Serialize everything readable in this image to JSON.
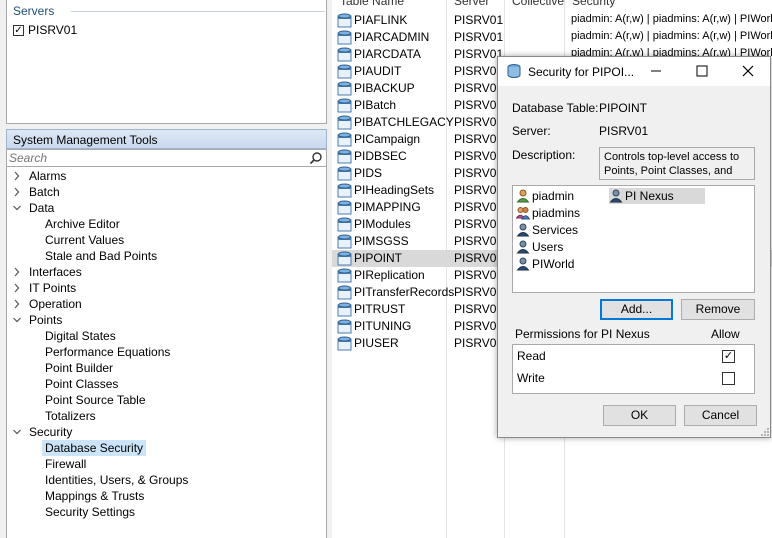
{
  "servers": {
    "title": "Servers",
    "items": [
      {
        "label": "PISRV01",
        "checked": true
      }
    ]
  },
  "tools": {
    "title": "System Management Tools",
    "search_placeholder": "Search",
    "tree": [
      {
        "label": "Alarms",
        "level": 0,
        "expanded": false
      },
      {
        "label": "Batch",
        "level": 0,
        "expanded": false
      },
      {
        "label": "Data",
        "level": 0,
        "expanded": true
      },
      {
        "label": "Archive Editor",
        "level": 1
      },
      {
        "label": "Current Values",
        "level": 1
      },
      {
        "label": "Stale and Bad Points",
        "level": 1
      },
      {
        "label": "Interfaces",
        "level": 0,
        "expanded": false
      },
      {
        "label": "IT Points",
        "level": 0,
        "expanded": false
      },
      {
        "label": "Operation",
        "level": 0,
        "expanded": false
      },
      {
        "label": "Points",
        "level": 0,
        "expanded": true
      },
      {
        "label": "Digital States",
        "level": 1
      },
      {
        "label": "Performance Equations",
        "level": 1
      },
      {
        "label": "Point Builder",
        "level": 1
      },
      {
        "label": "Point Classes",
        "level": 1
      },
      {
        "label": "Point Source Table",
        "level": 1
      },
      {
        "label": "Totalizers",
        "level": 1
      },
      {
        "label": "Security",
        "level": 0,
        "expanded": true
      },
      {
        "label": "Database Security",
        "level": 1,
        "selected": true
      },
      {
        "label": "Firewall",
        "level": 1
      },
      {
        "label": "Identities, Users, & Groups",
        "level": 1
      },
      {
        "label": "Mappings & Trusts",
        "level": 1
      },
      {
        "label": "Security Settings",
        "level": 1
      }
    ]
  },
  "table": {
    "columns": [
      "Table Name",
      "Server",
      "Collective",
      "Security"
    ],
    "rows": [
      {
        "name": "PIAFLINK",
        "server": "PISRV01",
        "security": "piadmin: A(r,w) | piadmins: A(r,w) | PIWorld: A(r)"
      },
      {
        "name": "PIARCADMIN",
        "server": "PISRV01",
        "security": "piadmin: A(r,w) | piadmins: A(r,w) | PIWorld: A(r)"
      },
      {
        "name": "PIARCDATA",
        "server": "PISRV01",
        "security": "piadmin: A(r,w) | piadmins: A(r,w) | PIWorld: A(r)"
      },
      {
        "name": "PIAUDIT",
        "server": "PISRV01",
        "security": ""
      },
      {
        "name": "PIBACKUP",
        "server": "PISRV01",
        "security": ""
      },
      {
        "name": "PIBatch",
        "server": "PISRV01",
        "security": ""
      },
      {
        "name": "PIBATCHLEGACY",
        "server": "PISRV01",
        "security": ""
      },
      {
        "name": "PICampaign",
        "server": "PISRV01",
        "security": ""
      },
      {
        "name": "PIDBSEC",
        "server": "PISRV01",
        "security": ""
      },
      {
        "name": "PIDS",
        "server": "PISRV01",
        "security": ""
      },
      {
        "name": "PIHeadingSets",
        "server": "PISRV01",
        "security": ""
      },
      {
        "name": "PIMAPPING",
        "server": "PISRV01",
        "security": ""
      },
      {
        "name": "PIModules",
        "server": "PISRV01",
        "security": ""
      },
      {
        "name": "PIMSGSS",
        "server": "PISRV01",
        "security": ""
      },
      {
        "name": "PIPOINT",
        "server": "PISRV01",
        "security": "",
        "selected": true
      },
      {
        "name": "PIReplication",
        "server": "PISRV01",
        "security": ""
      },
      {
        "name": "PITransferRecords",
        "server": "PISRV01",
        "security": ""
      },
      {
        "name": "PITRUST",
        "server": "PISRV01",
        "security": ""
      },
      {
        "name": "PITUNING",
        "server": "PISRV01",
        "security": ""
      },
      {
        "name": "PIUSER",
        "server": "PISRV01",
        "security": ""
      }
    ]
  },
  "dialog": {
    "title": "Security for PIPOI...",
    "db_table_label": "Database Table:",
    "db_table_value": "PIPOINT",
    "server_label": "Server:",
    "server_value": "PISRV01",
    "description_label": "Description:",
    "description_value": "Controls top-level access to Points, Point Classes, and",
    "identities": [
      {
        "label": "piadmin",
        "icon": "user-icon"
      },
      {
        "label": "piadmins",
        "icon": "group-icon"
      },
      {
        "label": "Services",
        "icon": "identity-icon"
      },
      {
        "label": "Users",
        "icon": "identity-icon"
      },
      {
        "label": "PIWorld",
        "icon": "identity-icon"
      },
      {
        "label": "PI Nexus",
        "icon": "identity-icon",
        "selected": true
      }
    ],
    "add_button": "Add...",
    "remove_button": "Remove",
    "permissions_label": "Permissions for PI Nexus",
    "allow_label": "Allow",
    "permissions": [
      {
        "label": "Read",
        "allowed": true
      },
      {
        "label": "Write",
        "allowed": false
      }
    ],
    "ok_button": "OK",
    "cancel_button": "Cancel"
  }
}
